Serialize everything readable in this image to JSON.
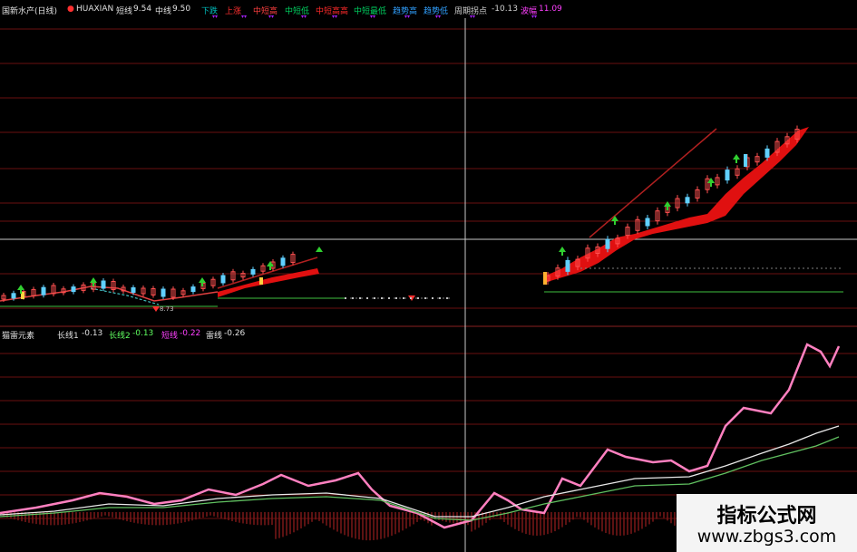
{
  "top_bar": {
    "stock_name": "国新水产(日线)",
    "ticker": "HUAXIAN",
    "short_line_label": "短线",
    "short_line_value": "9.54",
    "mid_line_label": "中线",
    "mid_line_value": "9.50",
    "items": [
      {
        "label": "下跌",
        "color": "#00c0c0"
      },
      {
        "label": "上涨",
        "color": "#ff3030"
      },
      {
        "label": "中短高",
        "color": "#ff4040"
      },
      {
        "label": "中短低",
        "color": "#00d060"
      },
      {
        "label": "中短高高",
        "color": "#ff2a2a"
      },
      {
        "label": "中短最低",
        "color": "#00d060"
      },
      {
        "label": "趋势高",
        "color": "#30a0ff"
      },
      {
        "label": "趋势低",
        "color": "#30a0ff"
      },
      {
        "label": "周期拐点",
        "color": "#d0d0d0"
      },
      {
        "label": "-10.13",
        "color": "#d0d0d0"
      },
      {
        "label": "波幅",
        "color": "#ff40ff"
      },
      {
        "label": "11.09",
        "color": "#ff40ff"
      }
    ]
  },
  "price_label": "8.73",
  "indicator_bar": {
    "name": "猫雷元素",
    "items": [
      {
        "label": "长线1",
        "value": "-0.13",
        "color": "#e0e0e0"
      },
      {
        "label": "长线2",
        "value": "-0.13",
        "color": "#60ff60"
      },
      {
        "label": "短线",
        "value": "-0.22",
        "color": "#ff40ff"
      },
      {
        "label": "雷线",
        "value": "-0.26",
        "color": "#e0e0e0"
      }
    ]
  },
  "watermark": {
    "title": "指标公式网",
    "url": "www.zbgs3.com"
  },
  "colors": {
    "background": "#000000",
    "grid": "#6a1010",
    "crosshair": "#c8c8c8",
    "ribbon": "#e01010",
    "support": "#40c040",
    "pink_line": "#ff80c0",
    "white_line": "#e8e8e8",
    "green_line": "#60c060"
  }
}
